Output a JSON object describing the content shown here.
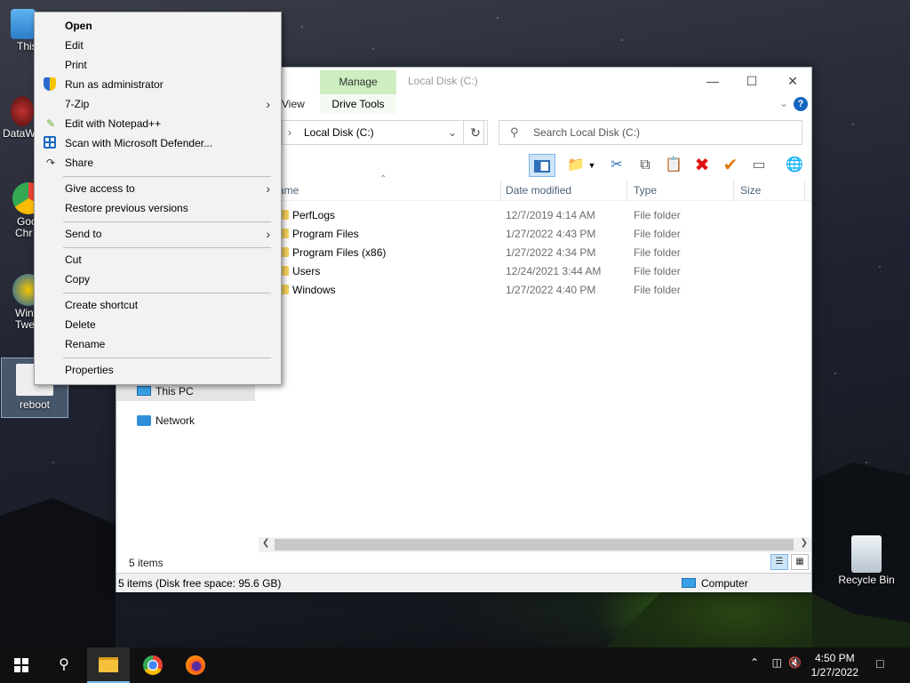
{
  "desktop": {
    "icons": [
      {
        "label": "This PC",
        "visible": "This"
      },
      {
        "label": "DataW",
        "visible": "DataW"
      },
      {
        "label": "Google Chrome",
        "line1": "Goo",
        "line2": "Chr"
      },
      {
        "label": "Winaero Tweaker",
        "line1": "Win",
        "line2": "Twe"
      },
      {
        "label": "reboot",
        "visible": "reboot"
      },
      {
        "label": "Recycle Bin",
        "visible": "Recycle Bin"
      }
    ]
  },
  "explorer": {
    "title": "Local Disk (C:)",
    "manage_tab": "Manage",
    "ribbon_tabs": {
      "view": "View",
      "drive_tools": "Drive Tools"
    },
    "help": "?",
    "address": "Local Disk (C:)",
    "search_placeholder": "Search Local Disk (C:)",
    "columns": {
      "name": "ame",
      "date": "Date modified",
      "type": "Type",
      "size": "Size"
    },
    "rows": [
      {
        "name": "PerfLogs",
        "date": "12/7/2019 4:14 AM",
        "type": "File folder"
      },
      {
        "name": "Program Files",
        "date": "1/27/2022 4:43 PM",
        "type": "File folder"
      },
      {
        "name": "Program Files (x86)",
        "date": "1/27/2022 4:34 PM",
        "type": "File folder"
      },
      {
        "name": "Users",
        "date": "12/24/2021 3:44 AM",
        "type": "File folder"
      },
      {
        "name": "Windows",
        "date": "1/27/2022 4:40 PM",
        "type": "File folder"
      }
    ],
    "nav": {
      "this_pc": "This PC",
      "network": "Network"
    },
    "item_count": "5 items",
    "status_left": "5 items (Disk free space: 95.6 GB)",
    "status_right": "Computer"
  },
  "context_menu": {
    "items": [
      {
        "label": "Open",
        "bold": true
      },
      {
        "label": "Edit"
      },
      {
        "label": "Print"
      },
      {
        "label": "Run as administrator",
        "icon": "shield-icon"
      },
      {
        "label": "7-Zip",
        "submenu": true
      },
      {
        "label": "Edit with Notepad++",
        "icon": "notepad-icon"
      },
      {
        "label": "Scan with Microsoft Defender...",
        "icon": "defender-icon"
      },
      {
        "label": "Share",
        "icon": "share-icon"
      },
      {
        "label": "Give access to",
        "submenu": true
      },
      {
        "label": "Restore previous versions"
      },
      {
        "label": "Send to",
        "submenu": true
      },
      {
        "label": "Cut"
      },
      {
        "label": "Copy"
      },
      {
        "label": "Create shortcut"
      },
      {
        "label": "Delete"
      },
      {
        "label": "Rename"
      },
      {
        "label": "Properties"
      }
    ]
  },
  "taskbar": {
    "time": "4:50 PM",
    "date": "1/27/2022"
  }
}
